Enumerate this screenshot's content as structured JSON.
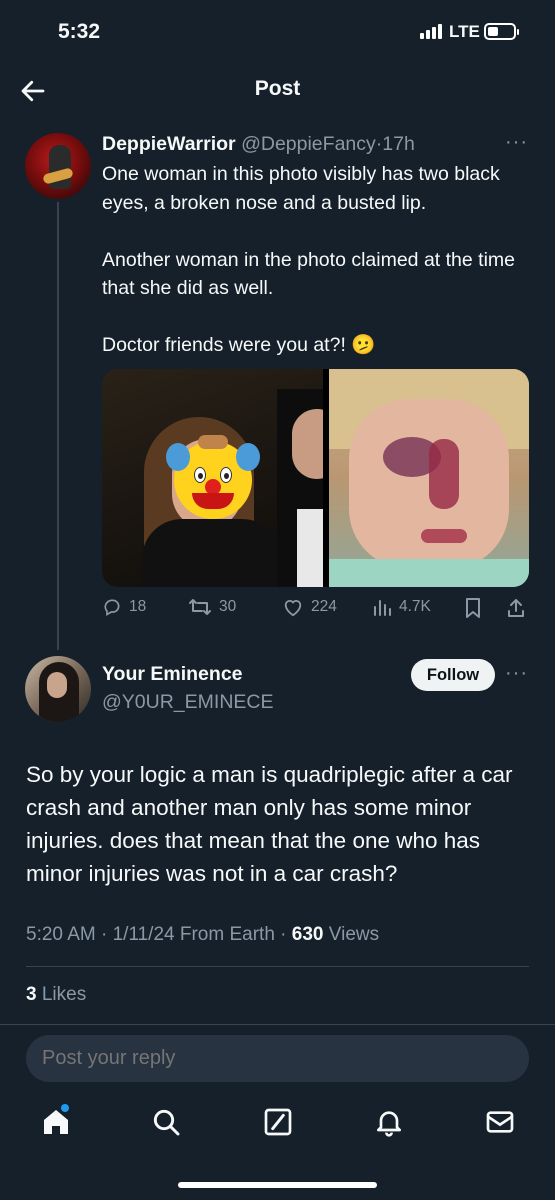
{
  "status_bar": {
    "time": "5:32",
    "network": "LTE"
  },
  "header": {
    "title": "Post"
  },
  "original_post": {
    "display_name": "DeppieWarrior",
    "handle": "@DeppieFancy",
    "time": "17h",
    "paragraphs": [
      "One woman in this photo visibly has two black eyes, a broken nose and a busted lip.",
      "Another woman in the photo claimed at the time that she did as well.",
      "Doctor friends were you at?! 🫤"
    ],
    "replies": "18",
    "reposts": "30",
    "likes": "224",
    "views": "4.7K"
  },
  "reply_post": {
    "display_name": "Your Eminence",
    "handle": "@Y0UR_EMINECE",
    "follow_label": "Follow",
    "text": "So by your logic a man is quadriplegic after a car crash and another man only has some minor injuries. does that mean that the one who has minor injuries was not in a car crash?",
    "time": "5:20 AM",
    "date": "1/11/24",
    "source": "From Earth",
    "views": "630",
    "views_label": "Views",
    "likes": "3",
    "likes_label": "Likes"
  },
  "composer": {
    "placeholder": "Post your reply"
  },
  "colors": {
    "background": "#15202b",
    "accent": "#1d9bf0",
    "muted": "#8b98a5"
  }
}
